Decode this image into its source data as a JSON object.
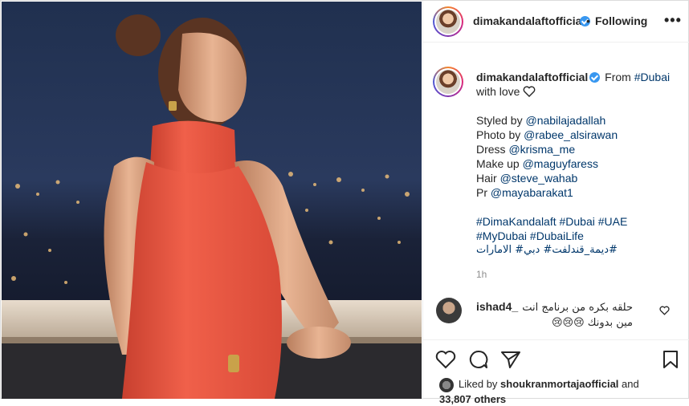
{
  "post": {
    "username": "dimakandalaftofficial",
    "follow_separator": "•",
    "follow_label": "Following",
    "more_label": "•••"
  },
  "caption": {
    "username": "dimakandalaftofficial",
    "intro_text": "From ",
    "intro_tag": "#Dubai",
    "intro_line2": "with love",
    "credits": [
      {
        "label": "Styled by ",
        "handle": "@nabilajadallah"
      },
      {
        "label": "Photo by ",
        "handle": "@rabee_alsirawan"
      },
      {
        "label": "Dress ",
        "handle": "@krisma_me"
      },
      {
        "label": "Make up ",
        "handle": "@maguyfaress"
      },
      {
        "label": "Hair ",
        "handle": "@steve_wahab"
      },
      {
        "label": "Pr ",
        "handle": "@mayabarakat1"
      }
    ],
    "hashtags_line1": "#DimaKandalaft #Dubai #UAE",
    "hashtags_line2": "#MyDubai #DubaiLife",
    "hashtags_line3": "ديمة_قندلفت# دبي# الامارات#",
    "time_ago": "1h"
  },
  "comment": {
    "username": "ishad4_",
    "text_line1": "حلقه بكره من برنامج انت",
    "text_line2": "مين بدونك 😢😢😢"
  },
  "likes": {
    "prefix": "Liked by ",
    "user": "shoukranmortajaofficial",
    "mid": " and",
    "count": "33,807 others"
  },
  "colors": {
    "link": "#00376b",
    "verified": "#3897f0",
    "dress": "#e8523f",
    "sky": "#1e2a4a"
  }
}
